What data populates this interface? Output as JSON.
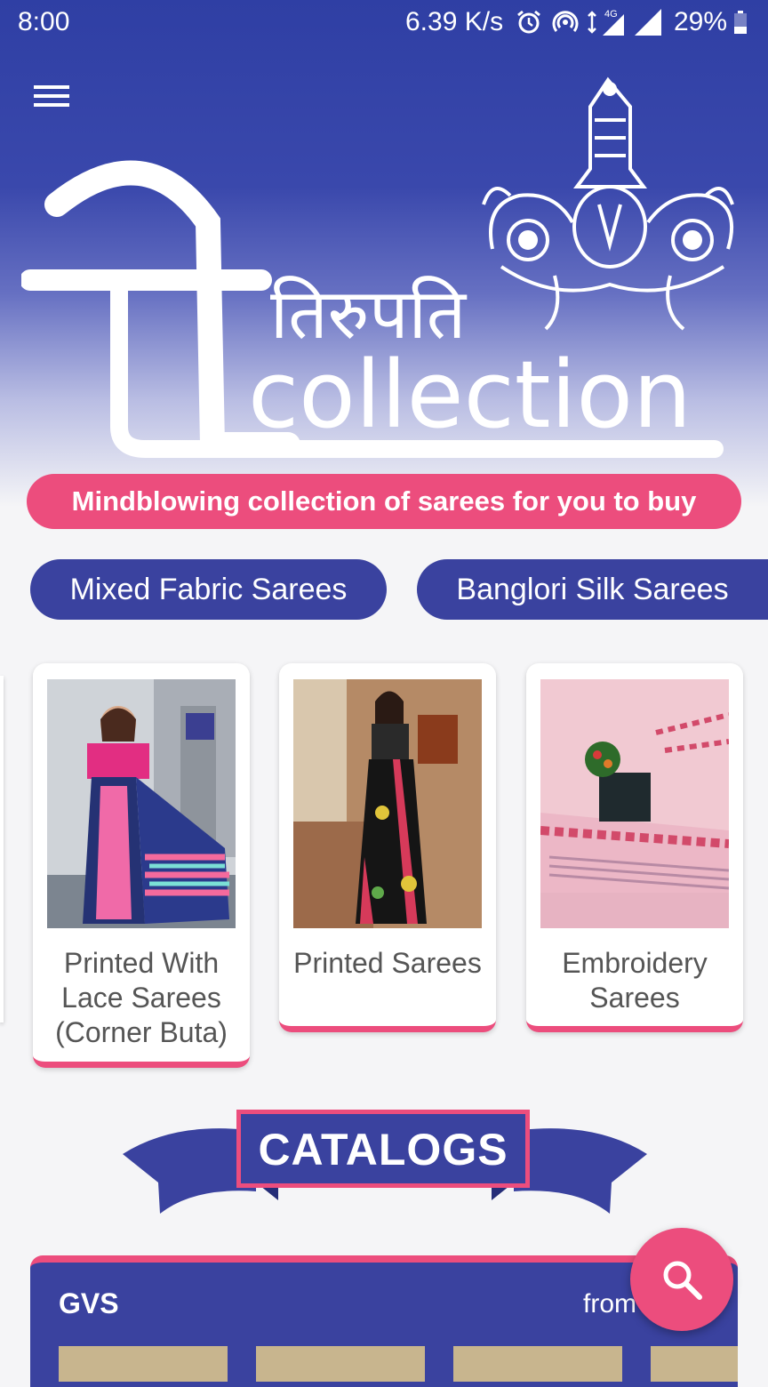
{
  "status_bar": {
    "time": "8:00",
    "speed": "6.39 K/s",
    "network_label": "4G",
    "battery": "29%"
  },
  "header": {
    "menu_icon": "hamburger-menu-icon",
    "logo": {
      "hindi_text": "तिरुपति",
      "english_text": "collection"
    },
    "tagline": "Mindblowing collection of sarees for you to buy"
  },
  "chips": [
    {
      "label": "Mixed Fabric Sarees"
    },
    {
      "label": "Banglori Silk Sarees"
    }
  ],
  "categories": [
    {
      "label": "Printed With Lace Sarees (Corner Buta)"
    },
    {
      "label": "Printed Sarees"
    },
    {
      "label": "Embroidery Sarees"
    }
  ],
  "catalogs": {
    "title": "CATALOGS",
    "first": {
      "name": "GVS",
      "from_label": "from"
    }
  },
  "fab": {
    "icon": "search-icon"
  },
  "colors": {
    "primary": "#3a429f",
    "accent": "#ec4d7d",
    "header_top": "#2f3fa4"
  }
}
